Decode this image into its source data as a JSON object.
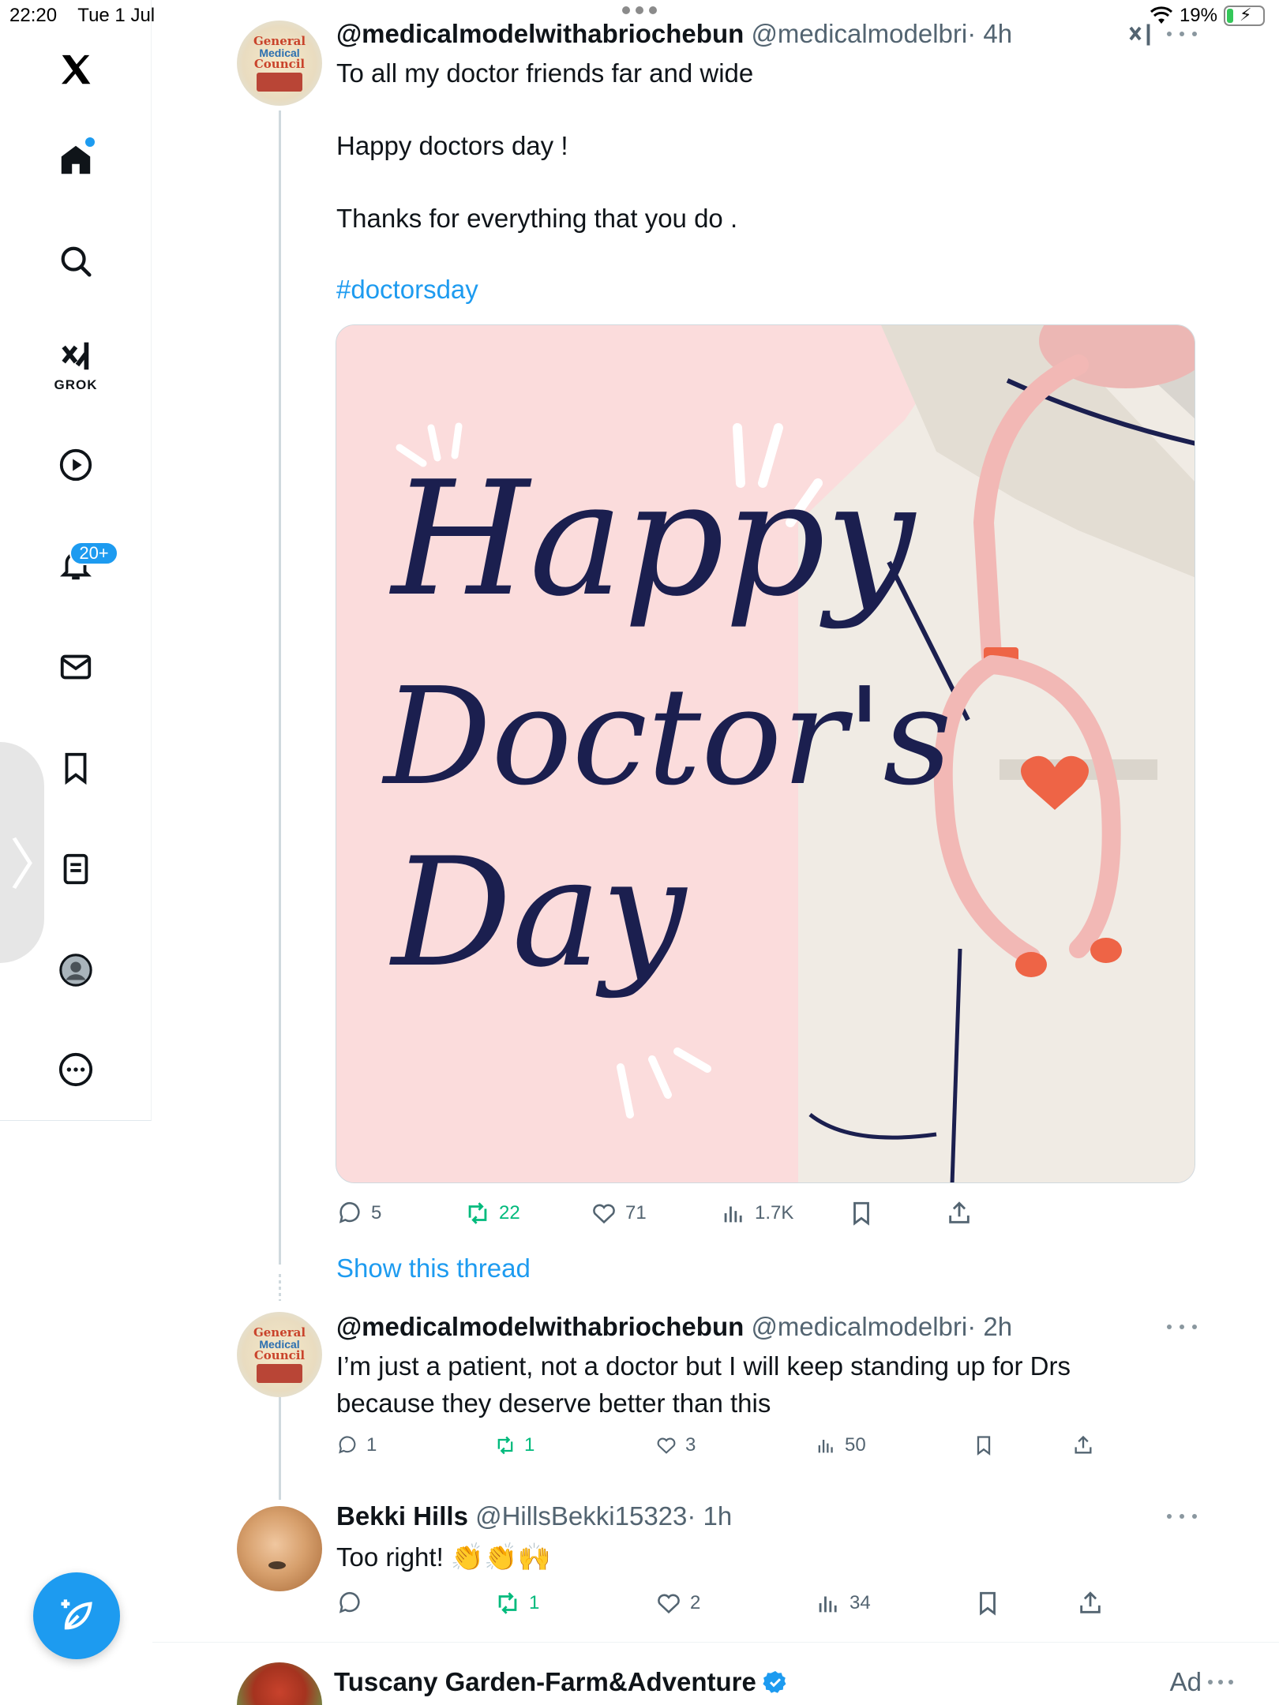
{
  "status_bar": {
    "time": "22:20",
    "date": "Tue 1 Jul",
    "battery": "19%",
    "battery_level": 0.19
  },
  "sidebar": {
    "grok_label": "GROK",
    "notifications_badge": "20+",
    "items": [
      {
        "name": "home",
        "icon": "home-icon"
      },
      {
        "name": "explore",
        "icon": "search-icon"
      },
      {
        "name": "grok",
        "icon": "grok-icon"
      },
      {
        "name": "videos",
        "icon": "play-icon"
      },
      {
        "name": "notifications",
        "icon": "bell-icon"
      },
      {
        "name": "messages",
        "icon": "mail-icon"
      },
      {
        "name": "bookmarks",
        "icon": "bookmark-icon"
      },
      {
        "name": "lists",
        "icon": "list-icon"
      },
      {
        "name": "profile",
        "icon": "profile-icon"
      },
      {
        "name": "more",
        "icon": "more-icon"
      }
    ]
  },
  "tweets": [
    {
      "name": "@medicalmodelwithabriochebun",
      "handle": "@medicalmodelbri",
      "time": "· 4h",
      "lines": [
        "To all my doctor friends far and wide",
        "Happy doctors day !",
        "Thanks for everything that you do ."
      ],
      "hashtag": "#doctorsday",
      "image_text": [
        "Happy",
        "Doctor's",
        "Day"
      ],
      "replies": "5",
      "reposts": "22",
      "likes": "71",
      "views": "1.7K",
      "show_thread": "Show this thread"
    },
    {
      "name": "@medicalmodelwithabriochebun",
      "handle": "@medicalmodelbri",
      "time": "· 2h",
      "lines": [
        "I’m just a patient, not a doctor but I will keep standing up for Drs",
        "because they deserve better than this"
      ],
      "replies": "1",
      "reposts": "1",
      "likes": "3",
      "views": "50"
    },
    {
      "name": "Bekki Hills",
      "handle": "@HillsBekki15323",
      "time": "· 1h",
      "text": "Too right!",
      "emojis": "👏👏🙌",
      "replies": "",
      "reposts": "1",
      "likes": "2",
      "views": "34"
    }
  ],
  "ad": {
    "name": "Tuscany Garden-Farm&Adventure",
    "label": "Ad"
  },
  "colors": {
    "accent": "#1d9bf0",
    "repost": "#00ba7c",
    "muted": "#536471",
    "image_pink": "#fbdcdc",
    "image_ink": "#1b1f4f",
    "stethoscope": "#f2b8b5",
    "heart": "#ee6446"
  }
}
